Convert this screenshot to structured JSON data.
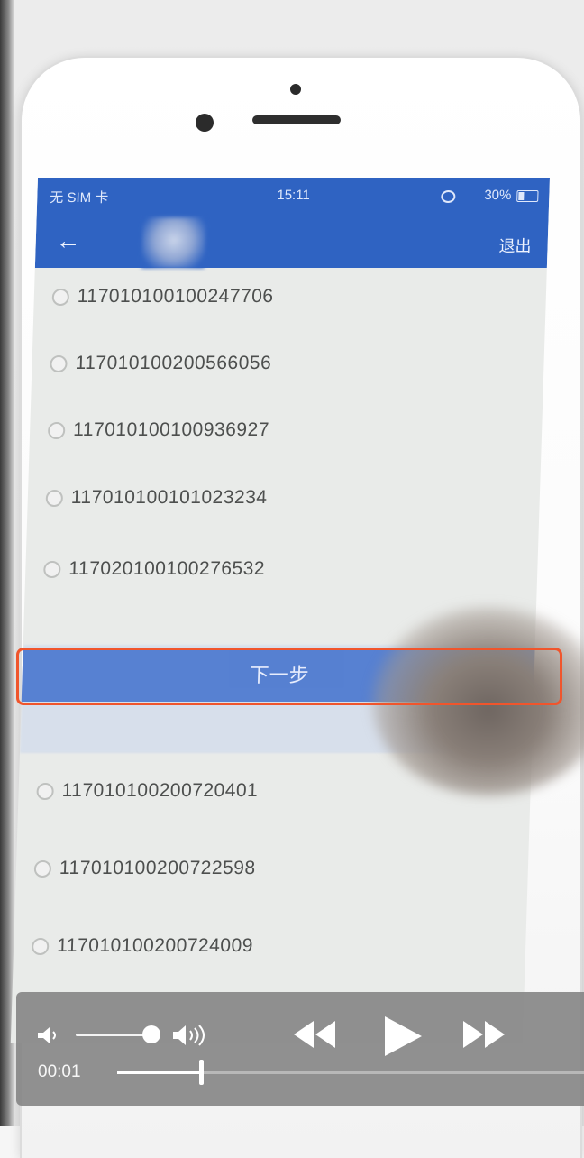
{
  "status_bar": {
    "carrier": "无 SIM 卡",
    "time": "15:11",
    "battery": "30%"
  },
  "nav": {
    "title": "",
    "logout_label": "退出"
  },
  "items": [
    {
      "code": "117010100100247706"
    },
    {
      "code": "117010100200566056"
    },
    {
      "code": "117010100100936927"
    },
    {
      "code": "117010100101023234"
    },
    {
      "code": "117020100100276532"
    },
    {
      "code": "117010100200720401"
    },
    {
      "code": "117010100200722598"
    },
    {
      "code": "117010100200724009"
    }
  ],
  "next_button": {
    "label": "下一步"
  },
  "player": {
    "elapsed": "00:01",
    "volume": 0.9,
    "progress": 0.18
  }
}
